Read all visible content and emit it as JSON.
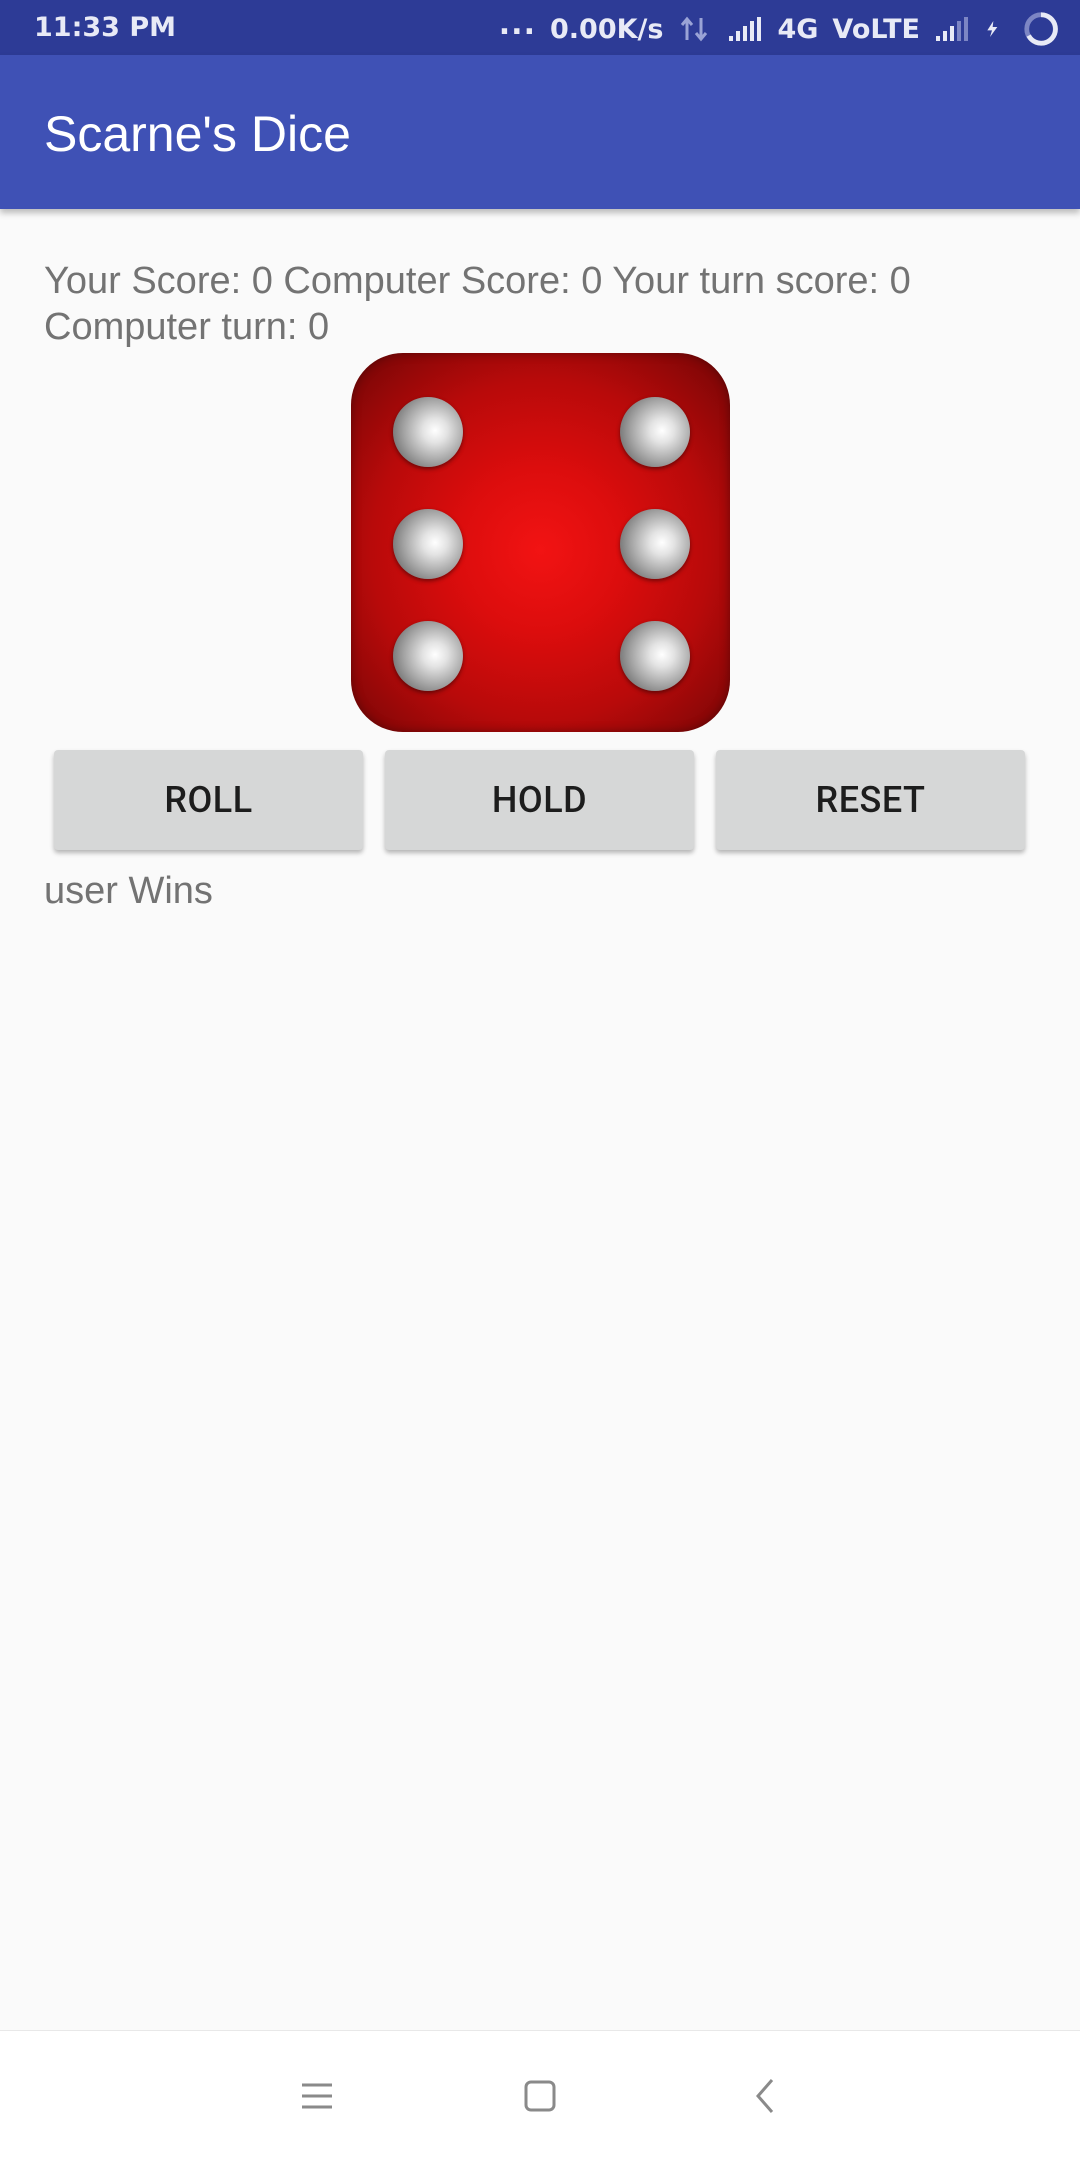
{
  "status_bar": {
    "time": "11:33 PM",
    "more_dots": "...",
    "net_speed": "0.00K/s",
    "network": "4G",
    "volte": "VoLTE"
  },
  "app_bar": {
    "title": "Scarne's Dice"
  },
  "scores": {
    "text": "Your Score: 0 Computer Score: 0 Your turn score: 0 Computer turn: 0"
  },
  "die": {
    "face_value": 6,
    "color": "#e01010"
  },
  "buttons": {
    "roll": "ROLL",
    "hold": "HOLD",
    "reset": "RESET"
  },
  "result": {
    "text": "user Wins"
  },
  "nav_bar": {
    "icons": [
      "menu-icon",
      "home-square-icon",
      "back-chevron-icon"
    ]
  },
  "colors": {
    "primary": "#3f51b5",
    "primary_dark": "#2d3b96",
    "button": "#d6d7d7",
    "text_secondary": "#737373"
  }
}
